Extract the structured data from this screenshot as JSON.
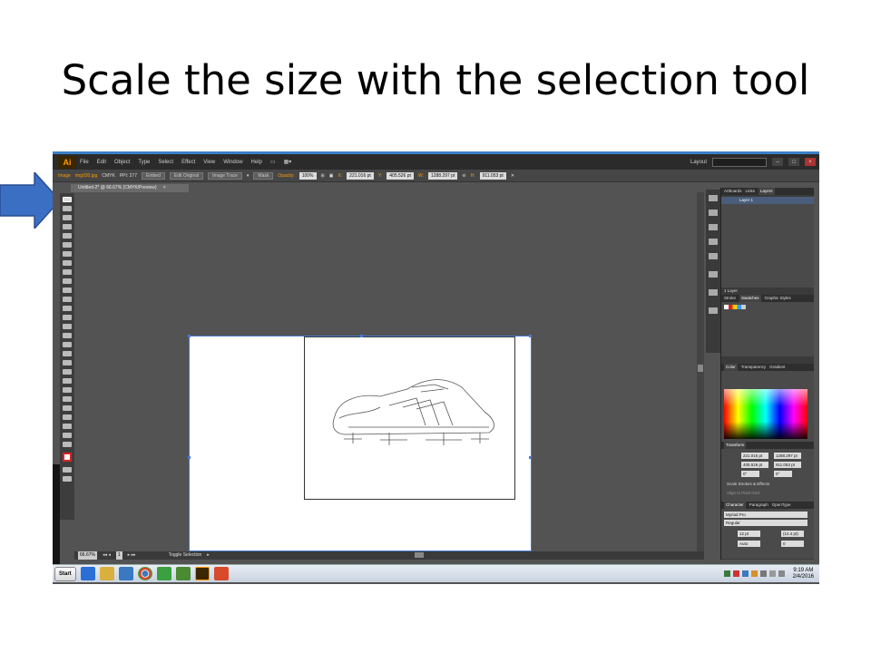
{
  "slide": {
    "title": "Scale the size with the selection tool"
  },
  "app": {
    "logo": "Ai",
    "menu": [
      "File",
      "Edit",
      "Object",
      "Type",
      "Select",
      "Effect",
      "View",
      "Window",
      "Help"
    ],
    "workspace": "Layout",
    "window_buttons": [
      "–",
      "□",
      "×"
    ]
  },
  "control_bar": {
    "object_type": "Image",
    "filename": "img030.jpg",
    "color_mode": "CMYK",
    "ppi": "PPI: 277",
    "embed": "Embed",
    "edit_original": "Edit Original",
    "image_trace": "Image Trace",
    "mask": "Mask",
    "opacity_label": "Opacity:",
    "opacity": "100%",
    "x_label": "X:",
    "x": "221.016 pt",
    "y_label": "Y:",
    "y": "405.526 pt",
    "w_label": "W:",
    "w": "1288.297 pt",
    "h_label": "H:",
    "h": "911.053 pt"
  },
  "document_tab": {
    "label": "Untitled-2* @ 66.67% (CMYK/Preview)",
    "close": "×"
  },
  "status_bar": {
    "zoom": "66.67%",
    "artboard": "1",
    "status": "Toggle Selection"
  },
  "panels": {
    "layers": {
      "tabs": [
        "Artboards",
        "Links",
        "Layers"
      ],
      "layer_name": "Layer 1",
      "footer": "1 Layer"
    },
    "swatches": {
      "tabs": [
        "Stroke",
        "Swatches",
        "Graphic Styles"
      ]
    },
    "color": {
      "tabs": [
        "Color",
        "Transparency",
        "Gradient"
      ]
    },
    "transform": {
      "tab": "Transform",
      "x": "221.016 pt",
      "w": "1288.297 pt",
      "y": "405.526 pt",
      "h": "911.053 pt",
      "angle": "0°",
      "shear": "0°",
      "scale_strokes": "Scale Strokes & Effects",
      "align_pixel": "Align to Pixel Grid"
    },
    "character": {
      "tabs": [
        "Character",
        "Paragraph",
        "OpenType"
      ],
      "font": "Myriad Pro",
      "style": "Regular",
      "size": "12 pt",
      "leading": "(14.4 pt)",
      "kerning": "Auto",
      "tracking": "0"
    }
  },
  "taskbar": {
    "start": "Start",
    "time": "9:19 AM",
    "date": "2/4/2016",
    "icon_colors": [
      "#2a6fd6",
      "#d9b040",
      "#3a78c0",
      "#d64a2a",
      "#3aa040",
      "#4a8a30",
      "#3a2600",
      "#d84a2a"
    ]
  },
  "colors": {
    "accent": "#3c7fc7",
    "ai_orange": "#ff9a00",
    "arrow": "#3a6fc4"
  }
}
